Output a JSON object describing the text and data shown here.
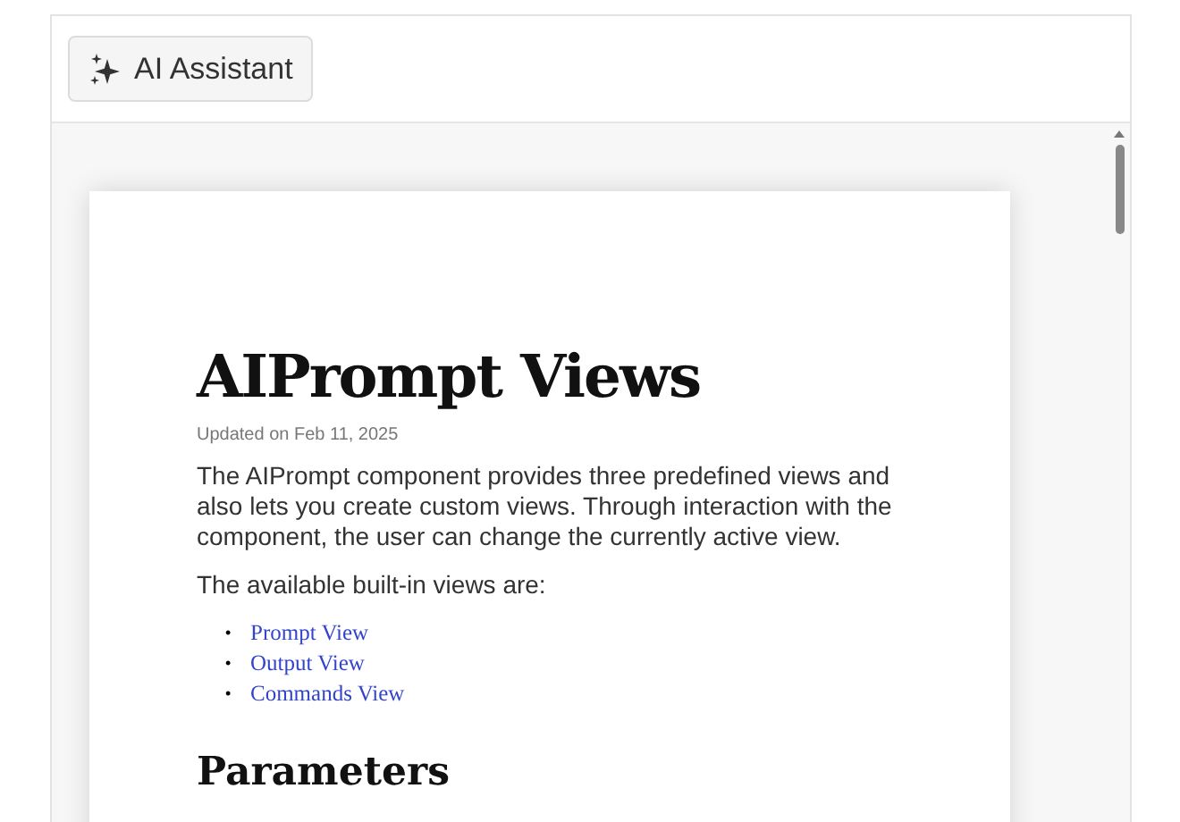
{
  "toolbar": {
    "button": {
      "label": "AI Assistant"
    }
  },
  "document": {
    "title": "AIPrompt Views",
    "updated": "Updated on Feb 11, 2025",
    "paragraphs": [
      "The AIPrompt component provides three predefined views and also lets you create custom views. Through interaction with the component, the user can change the currently active view.",
      "The available built-in views are:"
    ],
    "links": [
      {
        "marker": "•",
        "label": "Prompt View"
      },
      {
        "marker": "•",
        "label": "Output View"
      },
      {
        "marker": "•",
        "label": "Commands View"
      }
    ],
    "section_heading": "Parameters"
  }
}
